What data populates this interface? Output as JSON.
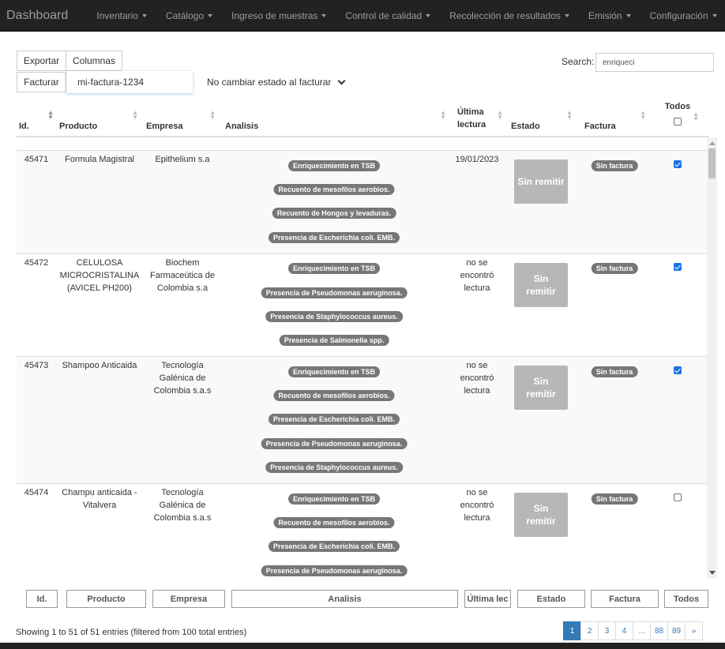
{
  "navbar": {
    "brand": "Dashboard",
    "items": [
      "Inventario",
      "Catálogo",
      "Ingreso de muestras",
      "Control de calidad",
      "Recolección de resultados",
      "Emisión",
      "Configuración"
    ]
  },
  "toolbar": {
    "export": "Exportar",
    "columns": "Columnas",
    "invoice": "Facturar",
    "invoice_value": "mi-factura-1234",
    "state_option": "No cambiar estado al facturar"
  },
  "search": {
    "label": "Search:",
    "value": "enriqueci"
  },
  "table": {
    "headers": {
      "id": "Id.",
      "producto": "Producto",
      "empresa": "Empresa",
      "analisis": "Analisis",
      "lectura": "Última lectura",
      "estado": "Estado",
      "factura": "Factura",
      "todos": "Todos"
    },
    "rows": [
      {
        "id": "45471",
        "producto": "Formula Magistral",
        "empresa": "Epithelium s.a",
        "analisis": [
          "Enriquecimiento en TSB",
          "Recuento de mesofilos aerobios.",
          "Recuento de Hongos y levaduras.",
          "Presencia de Escherichia coli. EMB."
        ],
        "lectura": "19/01/2023",
        "estado": "Sin remitir",
        "factura": "Sin factura",
        "checked": true
      },
      {
        "id": "45472",
        "producto": "CELULOSA MICROCRISTALINA (AVICEL PH200)",
        "empresa": "Biochem Farmaceútica de Colombia s.a",
        "analisis": [
          "Enriquecimiento en TSB",
          "Presencia de Pseudomonas aeruginosa.",
          "Presencia de Staphylococcus aureus.",
          "Presencia de Salmonella spp."
        ],
        "lectura": "no se encontró lectura",
        "estado": "Sin remitir",
        "factura": "Sin factura",
        "checked": true
      },
      {
        "id": "45473",
        "producto": "Shampoo Anticaida",
        "empresa": "Tecnología Galénica de Colombia s.a.s",
        "analisis": [
          "Enriquecimiento en TSB",
          "Recuento de mesofilos aerobios.",
          "Presencia de Escherichia coli. EMB.",
          "Presencia de Pseudomonas aeruginosa.",
          "Presencia de Staphylococcus aureus."
        ],
        "lectura": "no se encontró lectura",
        "estado": "Sin remitir",
        "factura": "Sin factura",
        "checked": true
      },
      {
        "id": "45474",
        "producto": "Champu anticaida - Vitalvera",
        "empresa": "Tecnología Galénica de Colombia s.a.s",
        "analisis": [
          "Enriquecimiento en TSB",
          "Recuento de mesofilos aerobios.",
          "Presencia de Escherichia coli. EMB.",
          "Presencia de Pseudomonas aeruginosa."
        ],
        "lectura": "no se encontró lectura",
        "estado": "Sin remitir",
        "factura": "Sin factura",
        "checked": false
      }
    ],
    "footer": [
      "Id.",
      "Producto",
      "Empresa",
      "Analisis",
      "Última lec",
      "Estado",
      "Factura",
      "Todos"
    ]
  },
  "info": "Showing 1 to 51 of 51 entries (filtered from 100 total entries)",
  "pagination": [
    "1",
    "2",
    "3",
    "4",
    "...",
    "88",
    "89",
    "»"
  ]
}
